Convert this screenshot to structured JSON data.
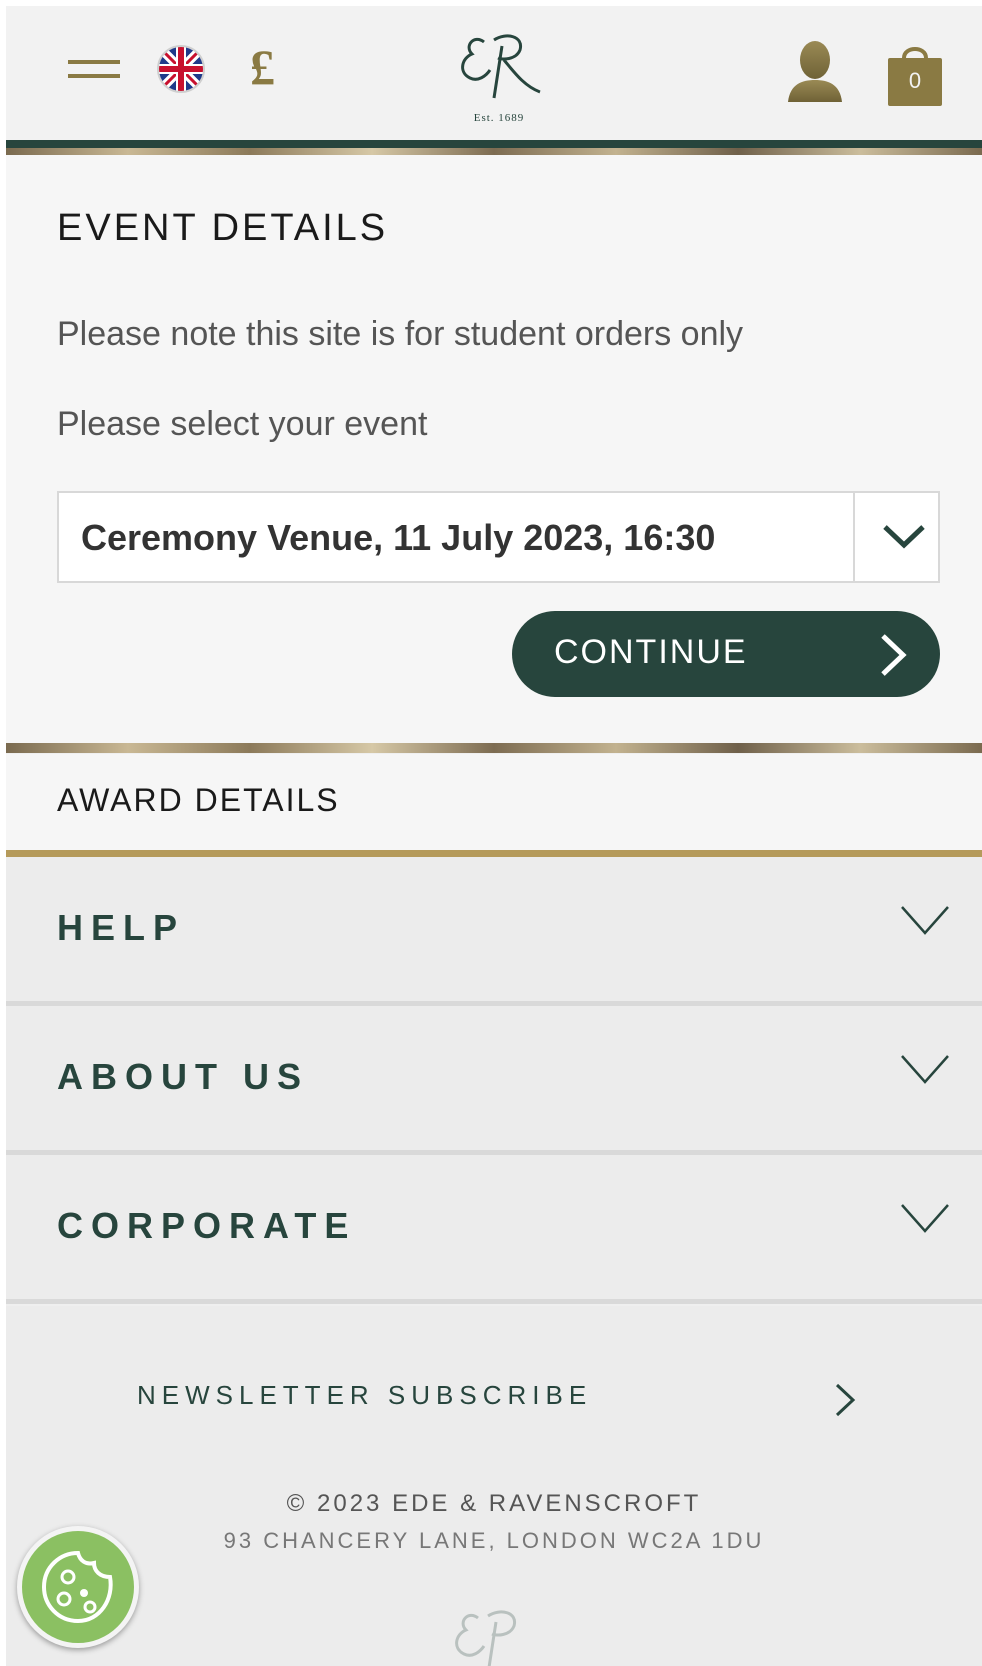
{
  "header": {
    "currency_symbol": "£",
    "logo_est": "Est. 1689",
    "basket_count": "0"
  },
  "event": {
    "title": "EVENT DETAILS",
    "note": "Please note this site is for student orders only",
    "select_label": "Please select your event",
    "selected_event": "Ceremony Venue, 11 July 2023, 16:30",
    "continue_label": "CONTINUE"
  },
  "award": {
    "label": "AWARD DETAILS"
  },
  "accordions": [
    {
      "label": "HELP"
    },
    {
      "label": "ABOUT US"
    },
    {
      "label": "CORPORATE"
    }
  ],
  "footer": {
    "newsletter": "NEWSLETTER SUBSCRIBE",
    "copyright": "© 2023 EDE & RAVENSCROFT",
    "address": "93 CHANCERY LANE, LONDON WC2A 1DU"
  },
  "colors": {
    "brand_green": "#27453d",
    "gold": "#8a7a43",
    "cookie_green": "#8bc062"
  }
}
